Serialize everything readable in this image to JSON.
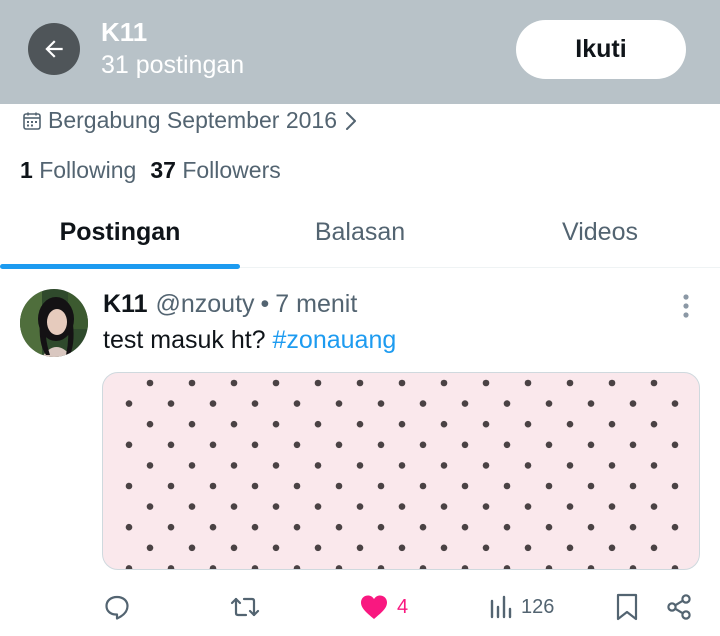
{
  "header": {
    "title": "K11",
    "subtitle": "31 postingan",
    "follow_label": "Ikuti",
    "background": "#b8c2c8"
  },
  "profile": {
    "joined": "Bergabung September 2016",
    "following_count": "1",
    "following_label": "Following",
    "followers_count": "37",
    "followers_label": "Followers"
  },
  "tabs": [
    {
      "label": "Postingan",
      "active": true
    },
    {
      "label": "Balasan",
      "active": false
    },
    {
      "label": "Videos",
      "active": false
    }
  ],
  "post": {
    "name": "K11",
    "handle": "@nzouty",
    "separator": "•",
    "time": "7 menit",
    "text": "test masuk ht? ",
    "hashtag": "#zonauang",
    "media": {
      "background": "#fae8ec",
      "dot_color": "#4a4244"
    },
    "actions": {
      "reply_icon": "reply-icon",
      "repost_icon": "repost-icon",
      "like_icon": "heart-filled-icon",
      "like_count": "4",
      "views_icon": "views-icon",
      "view_count": "126",
      "bookmark_icon": "bookmark-icon",
      "share_icon": "share-icon"
    }
  },
  "colors": {
    "accent": "#1d9bf0",
    "like": "#f91880",
    "text_primary": "#0f1419",
    "text_secondary": "#536471"
  }
}
